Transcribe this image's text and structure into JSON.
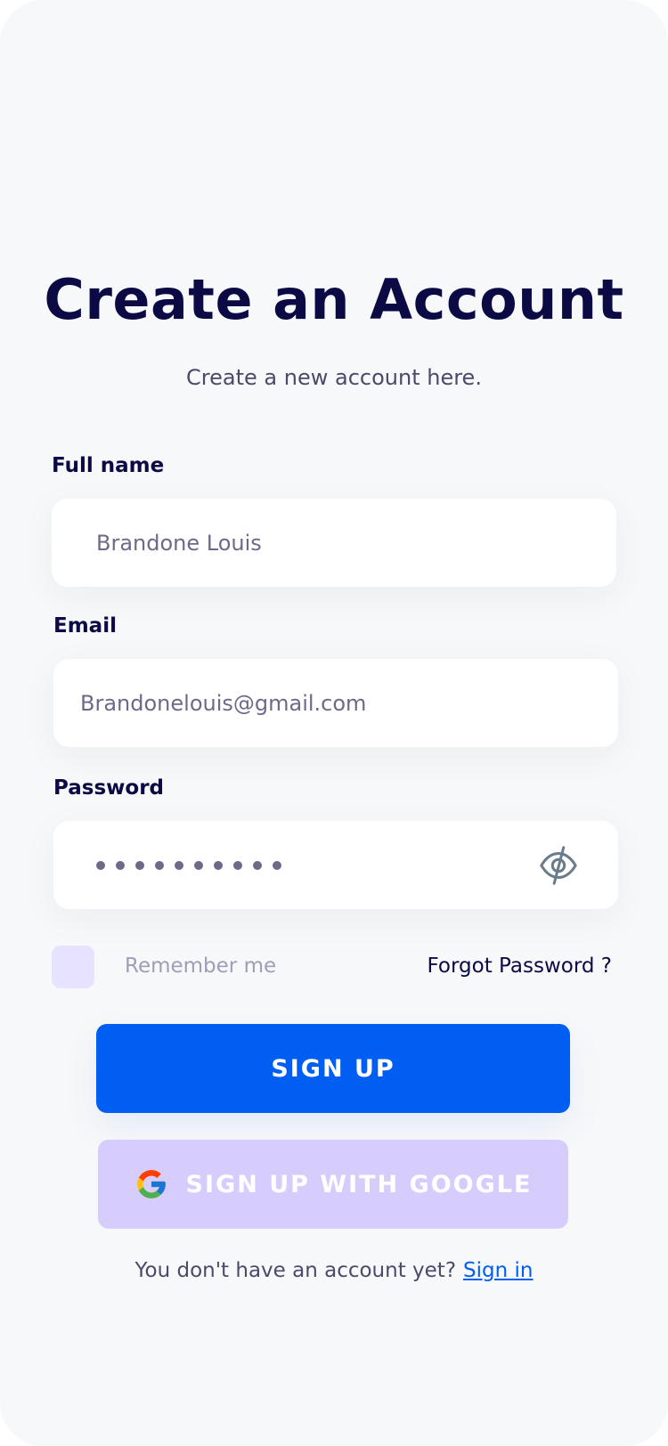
{
  "header": {
    "title": "Create an Account",
    "subtitle": "Create a new account here."
  },
  "form": {
    "full_name": {
      "label": "Full name",
      "value": "Brandone Louis"
    },
    "email": {
      "label": "Email",
      "value": "Brandonelouis@gmail.com"
    },
    "password": {
      "label": "Password",
      "masked_length": 10,
      "visibility_icon": "eye-slash-icon"
    },
    "remember_label": "Remember me",
    "remember_checked": false,
    "forgot_label": "Forgot Password ?"
  },
  "actions": {
    "signup_label": "SIGN UP",
    "google_label": "SIGN UP WITH GOOGLE",
    "google_icon": "google-icon"
  },
  "footer": {
    "prompt": "You don't have an account yet?",
    "link": "Sign in"
  },
  "colors": {
    "primary": "#005ef2",
    "heading": "#0b0a44",
    "google_button": "#d6cdfd",
    "checkbox": "#e6e2ff",
    "background": "#f7f8f9"
  }
}
